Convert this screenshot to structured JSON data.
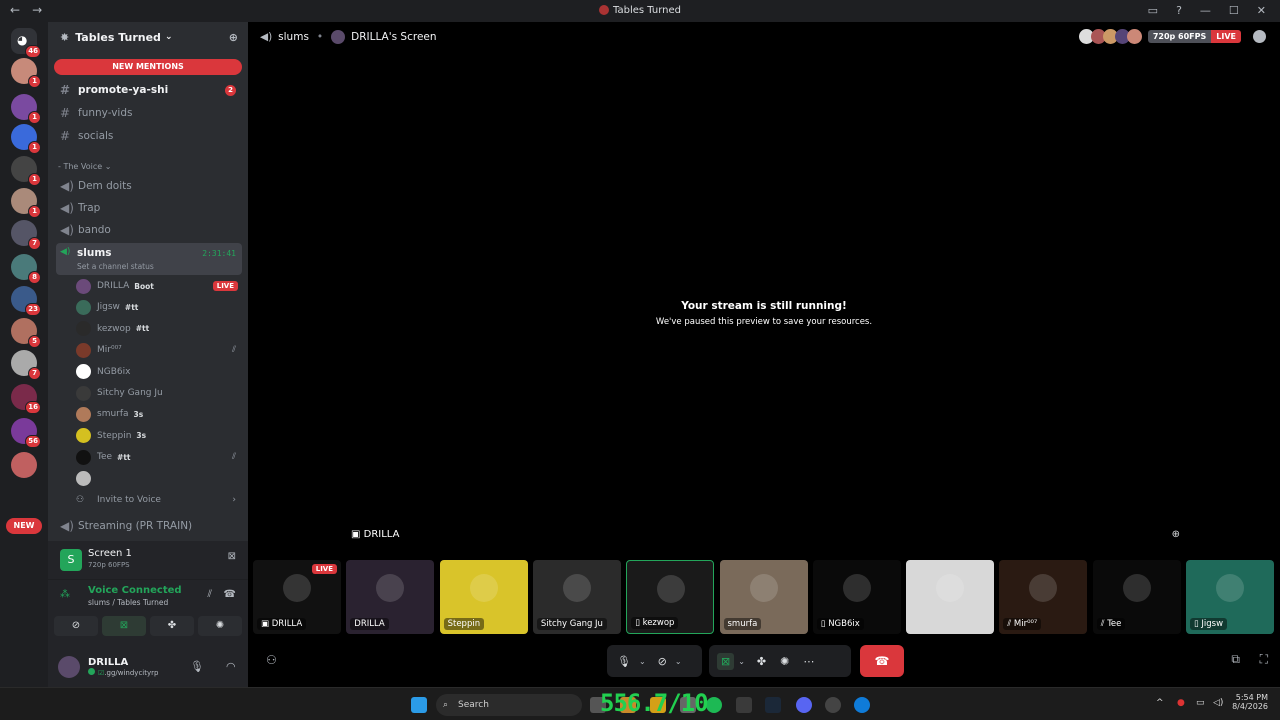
{
  "window": {
    "title": "Tables Turned",
    "back": "←",
    "forward": "→"
  },
  "servers": {
    "home_badge": "46",
    "badges": [
      "1",
      "1",
      "1",
      "1",
      "1",
      "7",
      "8",
      "23",
      "5",
      "7",
      "16",
      "56",
      ""
    ],
    "new_label": "NEW"
  },
  "sidebar": {
    "server_name": "Tables Turned",
    "new_mentions": "NEW MENTIONS",
    "text_channels": [
      {
        "name": "promote-ya-shi",
        "count": "2",
        "unread": true
      },
      {
        "name": "funny-vids",
        "count": "",
        "unread": false
      },
      {
        "name": "socials",
        "count": "",
        "unread": false
      }
    ],
    "category": "The Voice",
    "voice_channels": [
      "Dem doits",
      "Trap",
      "bando"
    ],
    "active_channel": {
      "name": "slums",
      "time": "2:31:41",
      "status": "Set a channel status"
    },
    "members": [
      {
        "name": "DRILLA",
        "tag": "Boot",
        "live": "LIVE",
        "color": "#6b4a7a"
      },
      {
        "name": "Jigsw",
        "tag": "#tt",
        "live": "",
        "color": "#3a6b5a"
      },
      {
        "name": "kezwop",
        "tag": "#tt",
        "live": "",
        "color": "#2a2a2a"
      },
      {
        "name": "Mir⁰⁰⁷",
        "tag": "",
        "live": "",
        "color": "#7a3a2a",
        "deaf": true
      },
      {
        "name": "NGB6ix",
        "tag": "",
        "live": "",
        "color": "#ffffff"
      },
      {
        "name": "Sitchy Gang Ju",
        "tag": "",
        "live": "",
        "color": "#3a3a3a"
      },
      {
        "name": "smurfa",
        "tag": "3s",
        "live": "",
        "color": "#b07a5a"
      },
      {
        "name": "Steppin",
        "tag": "3s",
        "live": "",
        "color": "#d4c020"
      },
      {
        "name": "Tee",
        "tag": "#tt",
        "live": "",
        "color": "#111111",
        "deaf": true
      },
      {
        "name": "",
        "tag": "",
        "live": "",
        "color": "#bbbbbb"
      }
    ],
    "invite": "Invite to Voice",
    "other_channel": "Streaming (PR TRAIN)"
  },
  "voice_panel": {
    "screen_title": "Screen 1",
    "screen_sub": "720p 60FPS",
    "connected": "Voice Connected",
    "connected_sub": "slums / Tables Turned"
  },
  "user": {
    "name": "DRILLA",
    "status": ".gg/windycityrp"
  },
  "main": {
    "channel": "slums",
    "stream_owner": "DRILLA's Screen",
    "quality": "720p 60FPS",
    "live": "LIVE",
    "paused_title": "Your stream is still running!",
    "paused_sub": "We've paused this preview to save your resources.",
    "focus_label": "DRILLA"
  },
  "tiles": [
    {
      "label": "DRILLA",
      "color": "#111111",
      "live": "LIVE",
      "icon": "screen-icon"
    },
    {
      "label": "DRILLA",
      "color": "#2a2230",
      "live": "",
      "icon": ""
    },
    {
      "label": "Steppin",
      "color": "#d9c42a",
      "live": "",
      "icon": ""
    },
    {
      "label": "Sitchy Gang Ju",
      "color": "#2b2b2b",
      "live": "",
      "icon": ""
    },
    {
      "label": "kezwop",
      "color": "#1a1a1a",
      "live": "",
      "icon": "phone-icon"
    },
    {
      "label": "smurfa",
      "color": "#7a6a5a",
      "live": "",
      "icon": ""
    },
    {
      "label": "NGB6ix",
      "color": "#0a0a0a",
      "live": "",
      "icon": "phone-icon"
    },
    {
      "label": "",
      "color": "#d8d8d8",
      "live": "",
      "icon": ""
    },
    {
      "label": "Mir⁰⁰⁷",
      "color": "#2a1a12",
      "live": "",
      "icon": "mute-icon"
    },
    {
      "label": "Tee",
      "color": "#0a0a0a",
      "live": "",
      "icon": "mute-icon"
    },
    {
      "label": "Jigsw",
      "color": "#1f6a5a",
      "live": "",
      "icon": "phone-icon"
    }
  ],
  "taskbar": {
    "search": "Search",
    "overlay": "556.7/10",
    "time": "5:54 PM",
    "date": "8/4/2026"
  }
}
